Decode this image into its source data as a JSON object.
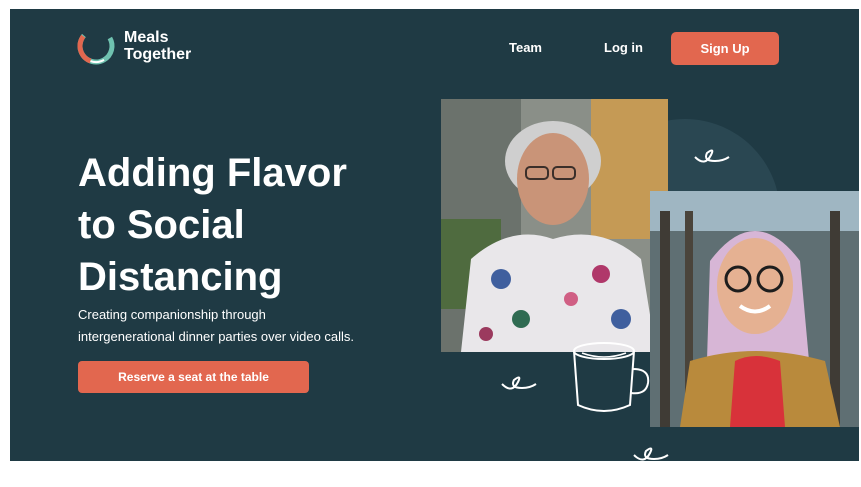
{
  "brand": {
    "name": "Meals\nTogether"
  },
  "nav": {
    "team": "Team",
    "login": "Log in",
    "signup": "Sign Up"
  },
  "hero": {
    "title": "Adding Flavor\nto Social\nDistancing",
    "subtitle": "Creating companionship through\nintergenerational dinner parties over video calls.",
    "cta": "Reserve a seat at the table"
  },
  "colors": {
    "background": "#1f3a44",
    "accent": "#e2674f",
    "text": "#ffffff"
  },
  "icons": [
    "logo-mark",
    "squiggle",
    "coffee-mug"
  ]
}
